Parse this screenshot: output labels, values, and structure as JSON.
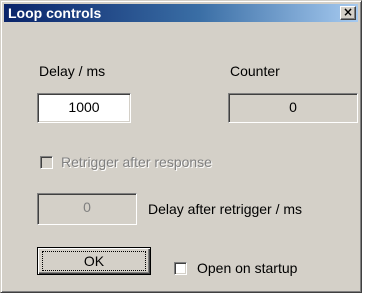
{
  "window": {
    "title": "Loop controls",
    "close_glyph": "×"
  },
  "delay": {
    "label": "Delay / ms",
    "value": "1000"
  },
  "counter": {
    "label": "Counter",
    "value": "0"
  },
  "retrigger": {
    "label": "Retrigger after response",
    "checked": false,
    "enabled": false
  },
  "retrigger_delay": {
    "value": "0",
    "label": "Delay after retrigger / ms"
  },
  "ok_button": {
    "label": "OK"
  },
  "open_on_startup": {
    "label": "Open on startup",
    "checked": false
  }
}
